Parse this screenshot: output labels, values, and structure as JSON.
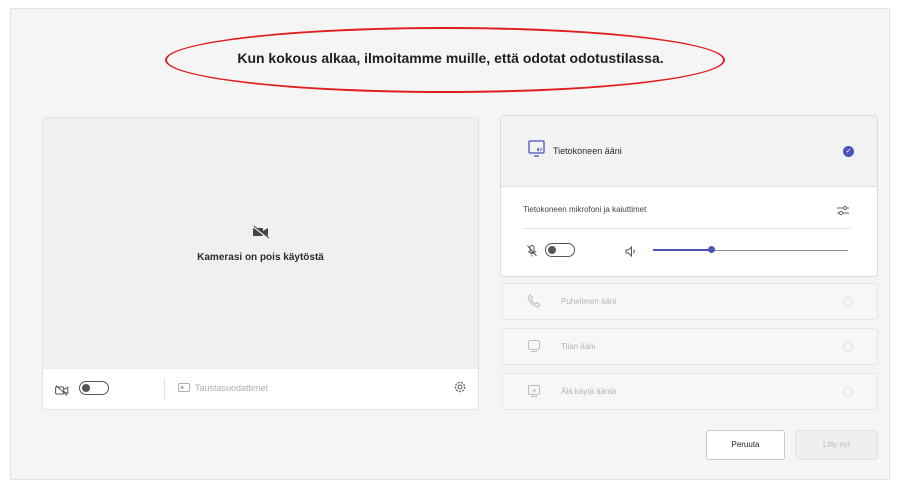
{
  "notice": "Kun kokous alkaa, ilmoitamme muille, että odotat odotustilassa.",
  "camera": {
    "off_label": "Kamerasi on pois käytöstä",
    "background_filters_label": "Taustasuodattimet",
    "camera_toggle_on": false
  },
  "audio": {
    "selected_option_label": "Tietokoneen ääni",
    "device_label": "Tietokoneen mikrofoni ja kaiuttimet",
    "mic_toggle_on": false,
    "volume_level": 0.3,
    "options": [
      {
        "label": "Puhelimen ääni",
        "icon": "phone-icon"
      },
      {
        "label": "Tilan ääni",
        "icon": "room-icon"
      },
      {
        "label": "Älä käytä ääntä",
        "icon": "no-audio-icon"
      }
    ]
  },
  "buttons": {
    "cancel": "Peruuta",
    "join_now": "Liity nyt"
  },
  "colors": {
    "accent": "#4b53bc",
    "annotation_ellipse": "#e01e1e"
  }
}
